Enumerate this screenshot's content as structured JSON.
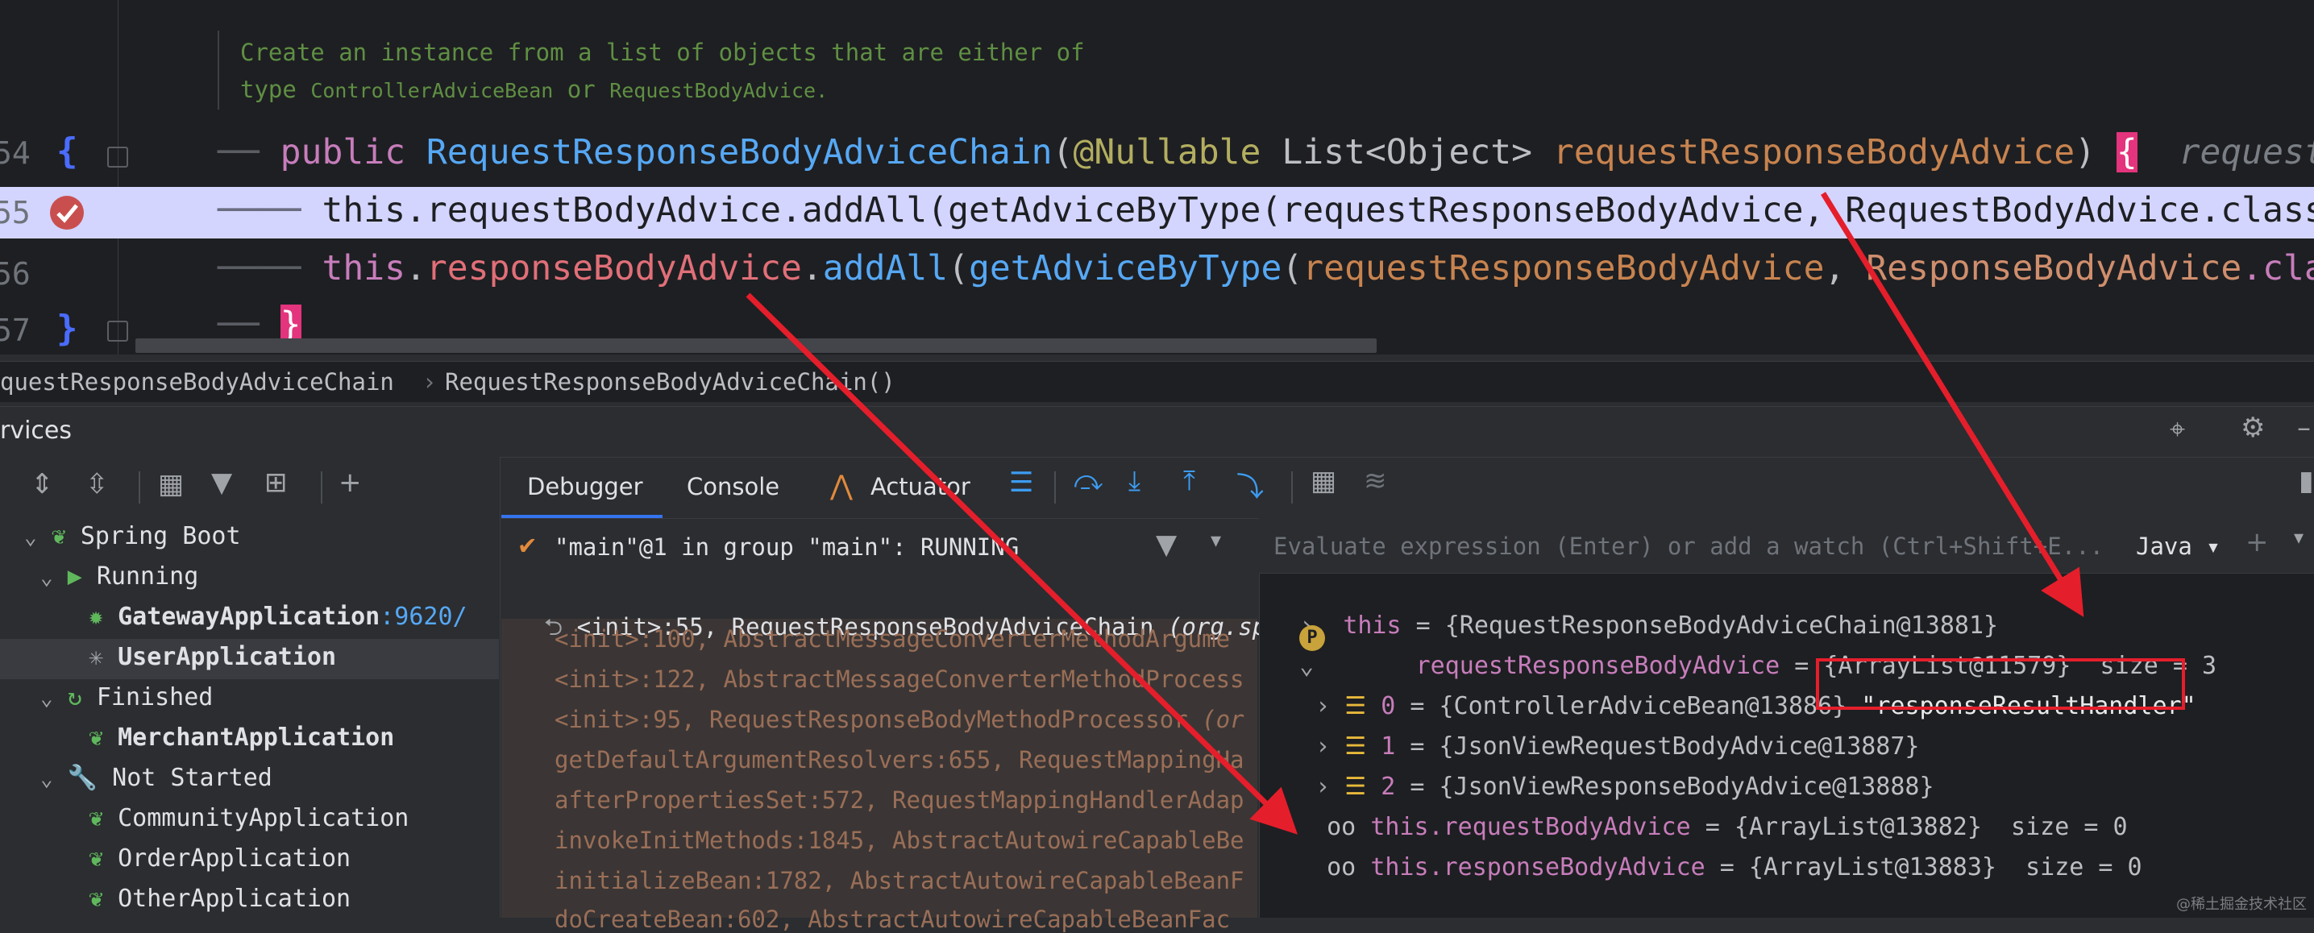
{
  "editor": {
    "doc_line1": "Create an instance from a list of objects that are either of",
    "doc_line2_prefix": "type ",
    "doc_line2_class1": "ControllerAdviceBean",
    "doc_line2_or": " or ",
    "doc_line2_class2": "RequestBodyAdvice",
    "doc_line2_end": ".",
    "lines": [
      {
        "num": "54",
        "fold": "{"
      },
      {
        "num": "55"
      },
      {
        "num": "56"
      },
      {
        "num": "57",
        "fold": "}"
      }
    ],
    "l54": {
      "public": "public",
      "method": "RequestResponseBodyAdviceChain",
      "open": "(",
      "ann": "@Nullable",
      "type": "List<Object>",
      "param": "requestResponseBodyAdvice",
      "close": ")",
      "brace": "{",
      "hint": "requestRe"
    },
    "l55": "this.requestBodyAdvice.addAll(getAdviceByType(requestResponseBodyAdvice, RequestBodyAdvice.class",
    "l56": {
      "this": "this",
      "dot": ".",
      "field": "responseBodyAdvice",
      "dot2": ".",
      "addAll": "addAll",
      "p1": "(",
      "getAdvice": "getAdviceByType",
      "p2": "(",
      "param": "requestResponseBodyAdvice",
      "comma": ", ",
      "cls": "ResponseBodyAdvice",
      "dotcla": ".cla"
    },
    "l57": "}"
  },
  "breadcrumb": {
    "item1": "questResponseBodyAdviceChain",
    "sep": "›",
    "item2": "RequestResponseBodyAdviceChain()"
  },
  "services": {
    "title": "rvices",
    "tree": [
      {
        "label": "Spring Boot",
        "level": 1
      },
      {
        "label": "Running",
        "level": 2
      },
      {
        "label": "GatewayApplication",
        "suffix": ":9620/",
        "level": 3
      },
      {
        "label": "UserApplication",
        "level": 3
      },
      {
        "label": "Finished",
        "level": 2
      },
      {
        "label": "MerchantApplication",
        "level": 3
      },
      {
        "label": "Not Started",
        "level": 2
      },
      {
        "label": "CommunityApplication",
        "level": 3
      },
      {
        "label": "OrderApplication",
        "level": 3
      },
      {
        "label": "OtherApplication",
        "level": 3
      }
    ]
  },
  "debugger": {
    "tabs": [
      "Debugger",
      "Console",
      "Actuator"
    ],
    "thread": "\"main\"@1 in group \"main\": RUNNING",
    "frames": [
      {
        "text": "<init>:55, RequestResponseBodyAdviceChain ",
        "pkg": "(org.sp",
        "current": true
      },
      {
        "text": "<init>:100, AbstractMessageConverterMethodArgume"
      },
      {
        "text": "<init>:122, AbstractMessageConverterMethodProcess"
      },
      {
        "text": "<init>:95, RequestResponseBodyMethodProcessor ",
        "pkg": "(or"
      },
      {
        "text": "getDefaultArgumentResolvers:655, RequestMappingHa"
      },
      {
        "text": "afterPropertiesSet:572, RequestMappingHandlerAdap"
      },
      {
        "text": "invokeInitMethods:1845, AbstractAutowireCapableBe"
      },
      {
        "text": "initializeBean:1782, AbstractAutowireCapableBeanF"
      },
      {
        "text": "doCreateBean:602, AbstractAutowireCapableBeanFac"
      }
    ],
    "eval_placeholder": "Evaluate expression (Enter) or add a watch (Ctrl+Shift+E...",
    "eval_lang": "Java",
    "vars": [
      {
        "name": "this",
        "value": " = {RequestResponseBodyAdviceChain@13881}"
      },
      {
        "name": "requestResponseBodyAdvice",
        "value": " = {ArrayList@11579}",
        "extra": "  size = 3"
      },
      {
        "name": "0",
        "value": " = {ControllerAdviceBean@13886}",
        "extra": " \"responseResultHandler\""
      },
      {
        "name": "1",
        "value": " = {JsonViewRequestBodyAdvice@13887}"
      },
      {
        "name": "2",
        "value": " = {JsonViewResponseBodyAdvice@13888}"
      },
      {
        "name": "this.requestBodyAdvice",
        "value": " = {ArrayList@13882}",
        "extra": "  size = 0"
      },
      {
        "name": "this.responseBodyAdvice",
        "value": " = {ArrayList@13883}",
        "extra": "  size = 0"
      }
    ]
  },
  "watermark": "@稀土掘金技术社区",
  "colors": {
    "accent": "#3574f0",
    "exec_line": "#d3d5ff",
    "annotation_arrow": "#e51e2b"
  }
}
